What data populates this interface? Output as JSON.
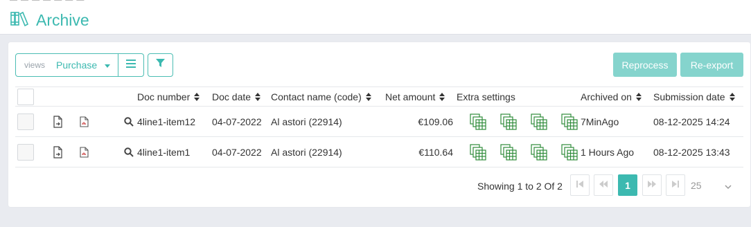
{
  "header": {
    "breadcrumb_fragment": "— — — — — — —",
    "title": "Archive"
  },
  "toolbar": {
    "views_label": "views",
    "views_value": "Purchase",
    "reprocess_label": "Reprocess",
    "reexport_label": "Re-export"
  },
  "table": {
    "columns": [
      "Doc number",
      "Doc date",
      "Contact name (code)",
      "Net amount",
      "Extra settings",
      "Archived on",
      "Submission date"
    ],
    "rows": [
      {
        "doc_number": "4line1-item12",
        "doc_date": "04-07-2022",
        "contact": "Al astori (22914)",
        "net_amount": "€109.06",
        "archived_on": "7MinAgo",
        "submission_date": "08-12-2025 14:24"
      },
      {
        "doc_number": "4line1-item1",
        "doc_date": "04-07-2022",
        "contact": "Al astori (22914)",
        "net_amount": "€110.64",
        "archived_on": "1 Hours Ago",
        "submission_date": "08-12-2025 13:43"
      }
    ]
  },
  "pagination": {
    "summary": "Showing 1 to 2 Of 2",
    "current_page": "1",
    "page_size": "25"
  },
  "colors": {
    "accent": "#3cb9b0",
    "accent_light": "#85d4cd",
    "excel_green": "#2e8b3a"
  },
  "icons": {
    "title": "archive-books-icon",
    "list": "list-icon",
    "filter": "filter-icon",
    "row_doc": "document-export-icon",
    "row_pdf": "pdf-icon",
    "row_search": "search-icon",
    "extra": "spreadsheet-copy-icon"
  }
}
